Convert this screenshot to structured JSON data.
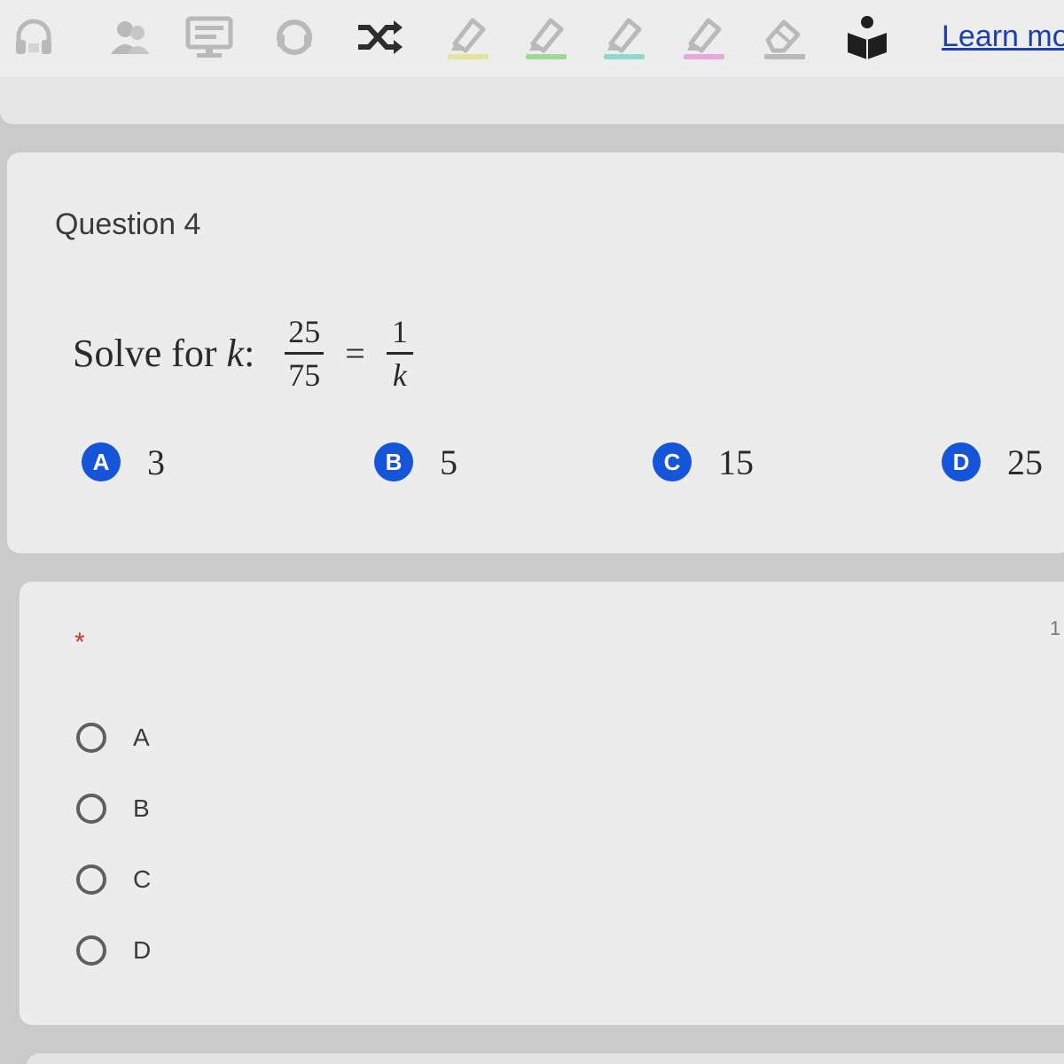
{
  "toolbar": {
    "tools": [
      {
        "icon": "headphones-icon",
        "color": "#b9b9b9"
      },
      {
        "icon": "people-icon",
        "color": "#b9b9b9"
      },
      {
        "icon": "monitor-icon",
        "color": "#b9b9b9"
      },
      {
        "icon": "support-icon",
        "color": "#b9b9b9"
      },
      {
        "icon": "shuffle-icon",
        "color": "#2d2d2d"
      },
      {
        "icon": "highlighter-yellow-icon",
        "color": "#e9e39a"
      },
      {
        "icon": "highlighter-green-icon",
        "color": "#9fd89a"
      },
      {
        "icon": "highlighter-teal-icon",
        "color": "#8fd8d0"
      },
      {
        "icon": "highlighter-pink-icon",
        "color": "#e6a8d8"
      },
      {
        "icon": "eraser-icon",
        "color": "#b9b9b9"
      },
      {
        "icon": "reader-icon",
        "color": "#1f1f1f"
      }
    ],
    "learn_more": "Learn mo"
  },
  "question": {
    "title": "Question 4",
    "prompt": {
      "text": "Solve for",
      "variable": "k",
      "colon": ":",
      "left_numerator": "25",
      "left_denominator": "75",
      "equals": "=",
      "right_numerator": "1",
      "right_denominator": "k"
    },
    "choices": [
      {
        "letter": "A",
        "value": "3"
      },
      {
        "letter": "B",
        "value": "5"
      },
      {
        "letter": "C",
        "value": "15"
      },
      {
        "letter": "D",
        "value": "25"
      }
    ]
  },
  "answer": {
    "required_mark": "*",
    "points": "1",
    "options": [
      "A",
      "B",
      "C",
      "D"
    ]
  },
  "colors": {
    "choice_badge": "#1455d9",
    "link": "#1a3fb0",
    "required": "#d93025"
  }
}
